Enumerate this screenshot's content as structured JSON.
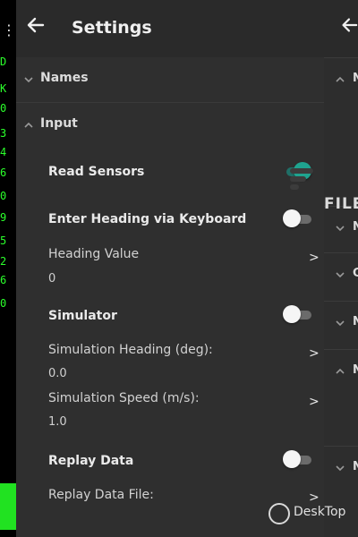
{
  "left_strip": {
    "menu_icon": "vertical-dots-icon",
    "chars": [
      "D",
      "K",
      "0",
      "3",
      "4",
      "6",
      "0",
      "9",
      "5",
      "2",
      "6",
      "0"
    ]
  },
  "appbar": {
    "title": "Settings",
    "back_icon": "arrow-left-icon"
  },
  "sections": {
    "names": {
      "title": "Names",
      "expanded": false
    },
    "input": {
      "title": "Input",
      "expanded": true
    }
  },
  "input_items": {
    "read_sensors": {
      "label": "Read Sensors",
      "on": true
    },
    "enter_heading": {
      "label": "Enter Heading via Keyboard",
      "on": false
    },
    "heading_value": {
      "label": "Heading Value",
      "value": "0",
      "arrow": ">"
    },
    "simulator": {
      "label": "Simulator",
      "on": false
    },
    "simulation_heading": {
      "label": "Simulation Heading (deg):",
      "value": "0.0",
      "arrow": ">"
    },
    "simulation_speed": {
      "label": "Simulation Speed (m/s):",
      "value": "1.0",
      "arrow": ">"
    },
    "replay_data": {
      "label": "Replay Data",
      "on": false
    },
    "replay_data_file": {
      "label": "Replay Data File:",
      "arrow": ">"
    }
  },
  "right_panel": {
    "back_icon": "arrow-left-icon",
    "rows": [
      "N",
      "N",
      "C",
      "N",
      "N",
      "N"
    ]
  },
  "watermarks": {
    "file": "FILE",
    "desktop": "DeskTop"
  },
  "colors": {
    "panel_bg": "#2f2f2f",
    "switch_on": "#1fa38f",
    "strip_green": "#21e221"
  }
}
